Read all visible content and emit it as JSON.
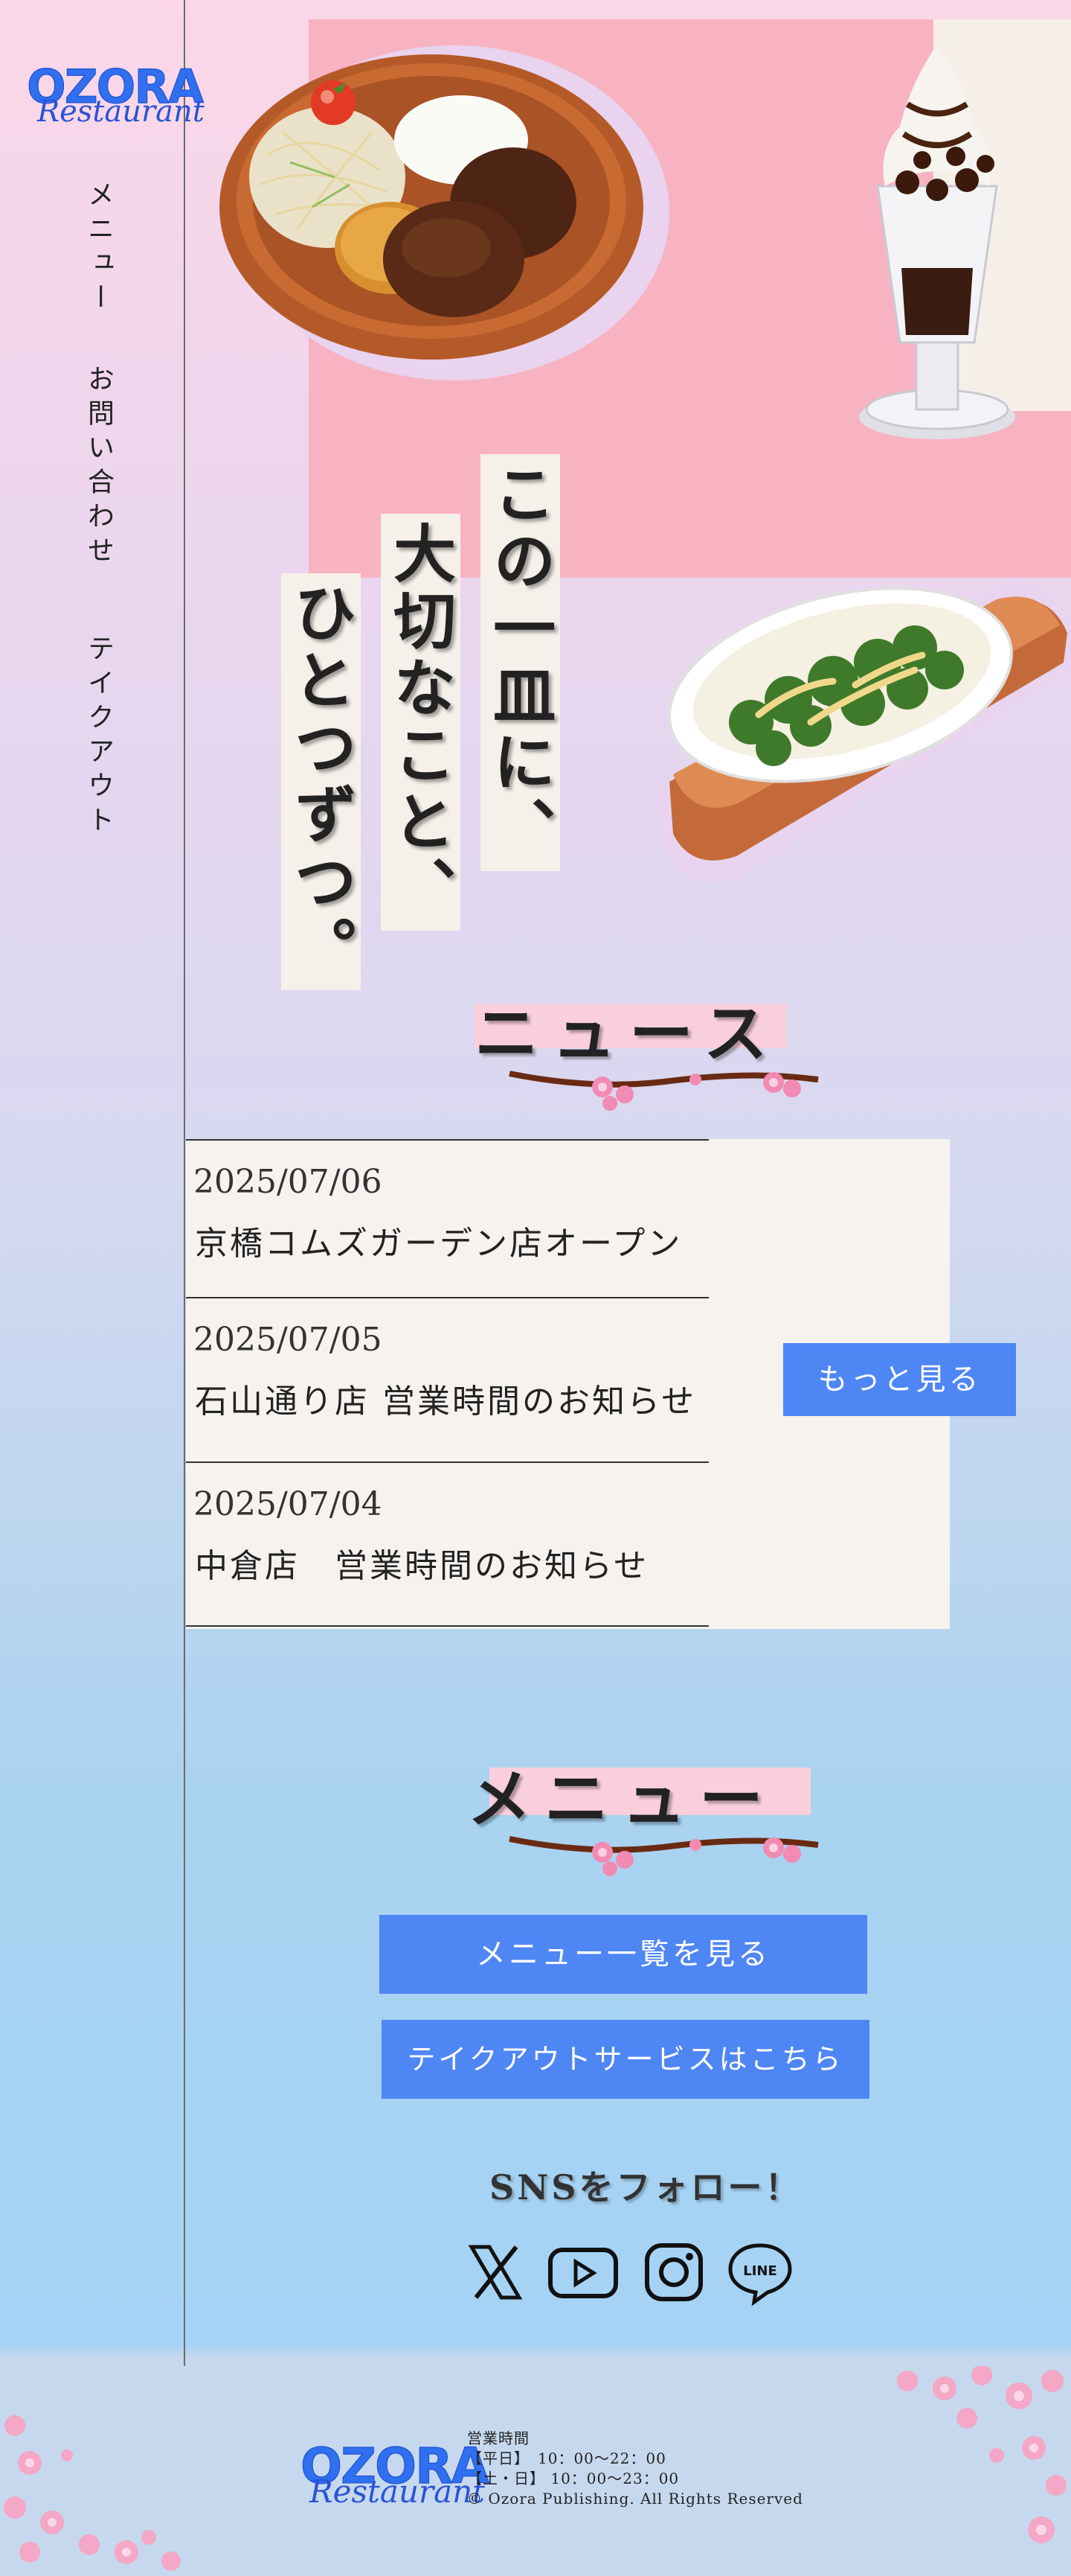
{
  "brand": {
    "logo_top": "OZORA",
    "logo_bottom": "Restaurant"
  },
  "nav": {
    "items": [
      "メニュー",
      "お問い合わせ",
      "テイクアウト"
    ]
  },
  "hero": {
    "lines": [
      "この一皿に、",
      "大切なこと、",
      "ひとつずつ。"
    ]
  },
  "news": {
    "heading": "ニュース",
    "items": [
      {
        "date": "2025/07/06",
        "title": "京橋コムズガーデン店オープン"
      },
      {
        "date": "2025/07/05",
        "title": "石山通り店 営業時間のお知らせ"
      },
      {
        "date": "2025/07/04",
        "title": "中倉店　営業時間のお知らせ"
      }
    ],
    "more_label": "もっと見る"
  },
  "menu": {
    "heading": "メニュー",
    "list_label": "メニュー一覧を見る",
    "takeout_label": "テイクアウトサービスはこちら"
  },
  "sns": {
    "heading": "SNSをフォロー！",
    "icons": [
      "x-icon",
      "youtube-icon",
      "instagram-icon",
      "line-icon"
    ],
    "line_text": "LINE"
  },
  "footer": {
    "logo_top": "OZORA",
    "logo_bottom": "Restaurant",
    "hours_label": "営業時間",
    "weekday": "【平日】　10：00～22：00",
    "weekend": "【土・日】 10：00～23：00",
    "copyright": "© Ozora Publishing. All Rights Reserved"
  },
  "colors": {
    "accent_blue": "#4e86f4",
    "brand_blue": "#2f6ff0",
    "pink": "#f8b3c3",
    "cream": "#f6f3ef"
  }
}
